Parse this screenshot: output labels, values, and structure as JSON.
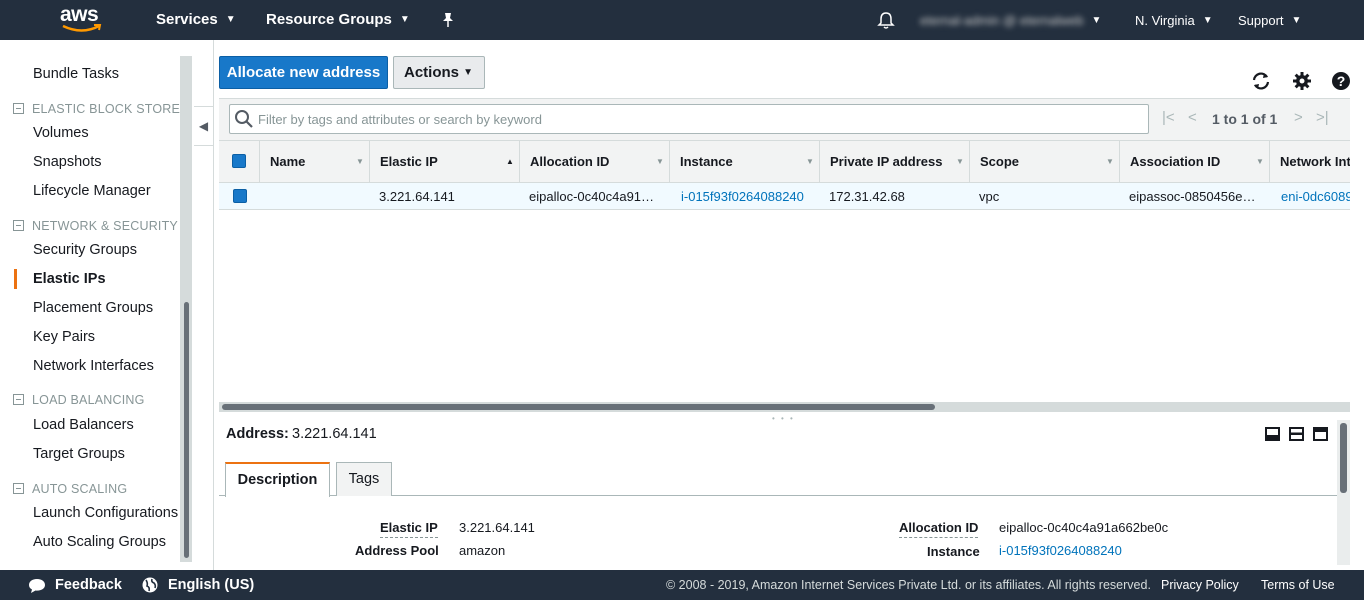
{
  "topnav": {
    "logo_text": "aws",
    "services": "Services",
    "resource_groups": "Resource Groups",
    "account": "eternal-admin @ eternalweb",
    "region": "N. Virginia",
    "support": "Support"
  },
  "sidebar": {
    "items_top": [
      {
        "label": "Bundle Tasks"
      }
    ],
    "sections": [
      {
        "title": "ELASTIC BLOCK STORE",
        "items": [
          "Volumes",
          "Snapshots",
          "Lifecycle Manager"
        ]
      },
      {
        "title": "NETWORK & SECURITY",
        "items": [
          "Security Groups",
          "Elastic IPs",
          "Placement Groups",
          "Key Pairs",
          "Network Interfaces"
        ]
      },
      {
        "title": "LOAD BALANCING",
        "items": [
          "Load Balancers",
          "Target Groups"
        ]
      },
      {
        "title": "AUTO SCALING",
        "items": [
          "Launch Configurations",
          "Auto Scaling Groups"
        ]
      }
    ],
    "active": "Elastic IPs"
  },
  "toolbar": {
    "allocate_label": "Allocate new address",
    "actions_label": "Actions",
    "icons": [
      "refresh-icon",
      "gear-icon",
      "help-icon"
    ]
  },
  "filter": {
    "placeholder": "Filter by tags and attributes or search by keyword",
    "pager_text": "1 to 1 of 1"
  },
  "table": {
    "headers": [
      "Name",
      "Elastic IP",
      "Allocation ID",
      "Instance",
      "Private IP address",
      "Scope",
      "Association ID",
      "Network Int"
    ],
    "rows": [
      {
        "name": "",
        "elastic_ip": "3.221.64.141",
        "allocation_id": "eipalloc-0c40c4a91…",
        "instance": "i-015f93f0264088240",
        "private_ip": "172.31.42.68",
        "scope": "vpc",
        "association_id": "eipassoc-0850456e…",
        "network_interface": "eni-0dc6089"
      }
    ]
  },
  "detail": {
    "label": "Address:",
    "value": "3.221.64.141",
    "tabs": [
      "Description",
      "Tags"
    ],
    "fields_left": [
      {
        "label": "Elastic IP",
        "value": "3.221.64.141"
      },
      {
        "label": "Address Pool",
        "value": "amazon"
      }
    ],
    "fields_right": [
      {
        "label": "Allocation ID",
        "value": "eipalloc-0c40c4a91a662be0c"
      },
      {
        "label": "Instance",
        "value": "i-015f93f0264088240"
      }
    ]
  },
  "footer": {
    "feedback": "Feedback",
    "language": "English (US)",
    "copyright": "© 2008 - 2019, Amazon Internet Services Private Ltd. or its affiliates. All rights reserved.",
    "privacy": "Privacy Policy",
    "terms": "Terms of Use"
  },
  "colors": {
    "nav_bg": "#232f3e",
    "primary_button": "#1878c9",
    "accent_orange": "#ec7211",
    "link": "#0073bb"
  }
}
